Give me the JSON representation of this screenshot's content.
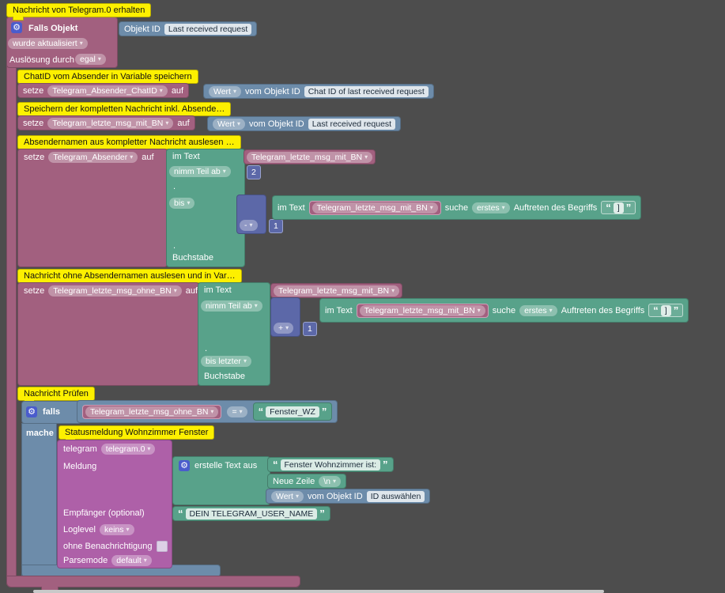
{
  "colors": {
    "canvas": "#4d4d4d",
    "trigger_block": "#a2607f",
    "value_block": "#6d8caa",
    "text_block": "#58a28a",
    "math_block": "#5c68a8",
    "telegram_block": "#ae60a8",
    "comment": "#fdf000",
    "scrollbar": "#c9c9c9"
  },
  "workspace": {
    "trigger": {
      "comment": "Nachricht von Telegram.0 erhalten",
      "title": "Falls Objekt",
      "objekt_id_label": "Objekt ID",
      "objekt_id_value": "Last received request",
      "updated": "wurde aktualisiert",
      "trigger_by_label": "Auslösung durch",
      "trigger_by": "egal"
    },
    "set_chat_id": {
      "comment": "ChatID vom Absender in Variable speichern",
      "setze": "setze",
      "variable": "Telegram_Absender_ChatID",
      "auf": "auf",
      "wert": "Wert",
      "vom_objekt_id": "vom Objekt ID",
      "objekt_id": "Chat ID of last received request"
    },
    "set_full_msg": {
      "comment": "Speichern der kompletten Nachricht inkl. Absende…",
      "setze": "setze",
      "variable": "Telegram_letzte_msg_mit_BN",
      "auf": "auf",
      "wert": "Wert",
      "vom_objekt_id": "vom Objekt ID",
      "objekt_id": "Last received request"
    },
    "parse_sender": {
      "comment": "Absendernamen aus kompletter Nachricht auslesen …",
      "setze": "setze",
      "variable": "Telegram_Absender",
      "auf": "auf",
      "im_text": "im Text",
      "source_variable": "Telegram_letzte_msg_mit_BN",
      "from": "nimm Teil ab",
      "from_value": "2",
      "dot1": ".",
      "to": "bis",
      "dot2": ".",
      "letter": "Buchstabe",
      "math_op": "-",
      "math_value": "1",
      "find": {
        "im_text": "im Text",
        "variable": "Telegram_letzte_msg_mit_BN",
        "suche": "suche",
        "mode": "erstes",
        "auftreten": "Auftreten des Begriffs",
        "term": "]"
      }
    },
    "parse_message": {
      "comment": "Nachricht ohne Absendernamen auslesen und in Var…",
      "setze": "setze",
      "variable": "Telegram_letzte_msg_ohne_BN",
      "auf": "auf",
      "im_text": "im Text",
      "source_variable": "Telegram_letzte_msg_mit_BN",
      "from": "nimm Teil ab",
      "dot": ".",
      "to": "bis letzter",
      "letter": "Buchstabe",
      "math_op": "+",
      "math_value": "1",
      "find": {
        "im_text": "im Text",
        "variable": "Telegram_letzte_msg_mit_BN",
        "suche": "suche",
        "mode": "erstes",
        "auftreten": "Auftreten des Begriffs",
        "term": "]"
      }
    },
    "check": {
      "comment": "Nachricht Prüfen",
      "falls": "falls",
      "condition_variable": "Telegram_letzte_msg_ohne_BN",
      "operator": "=",
      "compare_value": "Fenster_WZ",
      "mache": "mache",
      "action_comment": "Statusmeldung Wohnzimmer Fenster",
      "telegram": {
        "label": "telegram",
        "instance": "telegram.0",
        "meldung_label": "Meldung",
        "join": {
          "title": "erstelle Text aus",
          "text1": "Fenster Wohnzimmer ist:",
          "newline_label": "Neue Zeile",
          "newline_value": "\\n",
          "wert": "Wert",
          "vom_objekt_id": "vom Objekt ID",
          "objekt_id": "ID auswählen"
        },
        "empfaenger_label": "Empfänger (optional)",
        "empfaenger_value": "DEIN TELEGRAM_USER_NAME",
        "loglevel_label": "Loglevel",
        "loglevel_value": "keins",
        "silent_label": "ohne Benachrichtigung",
        "parsemode_label": "Parsemode",
        "parsemode_value": "default"
      }
    }
  }
}
